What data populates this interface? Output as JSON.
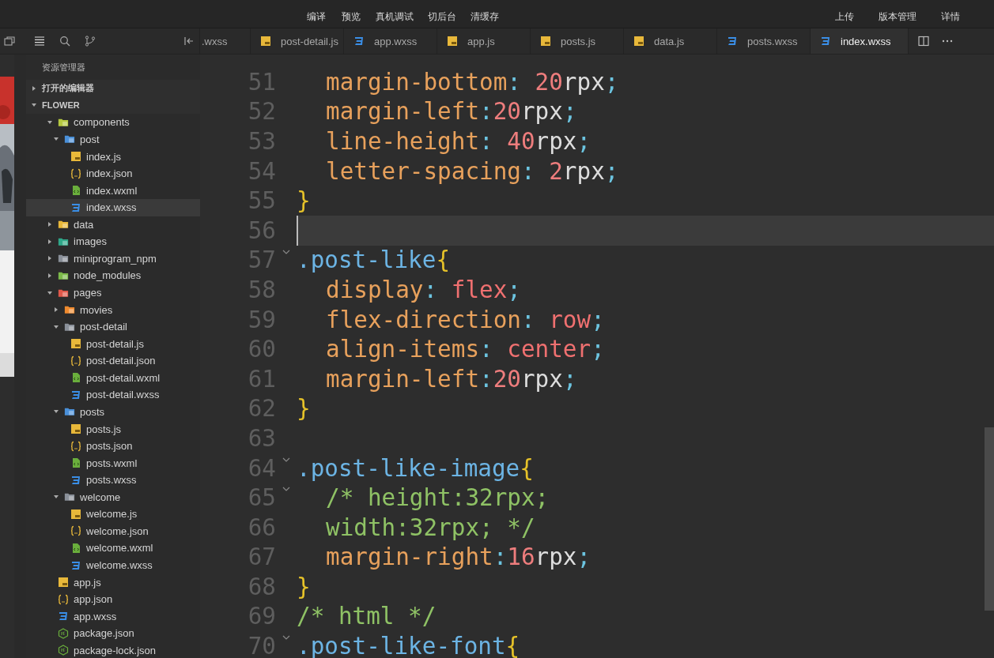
{
  "toolbar": {
    "left_buttons": [
      "编译",
      "预览",
      "真机调试",
      "切后台",
      "清缓存"
    ],
    "right_buttons": [
      "上传",
      "版本管理",
      "详情"
    ]
  },
  "sidebar": {
    "title": "资源管理器",
    "sections": [
      {
        "label": "打开的编辑器",
        "expanded": false
      },
      {
        "label": "FLOWER",
        "expanded": true,
        "children": [
          {
            "label": "components",
            "kind": "folder",
            "color": "#b5c940",
            "expanded": true,
            "selected": false,
            "children": [
              {
                "label": "post",
                "kind": "folder",
                "color": "#4a90d9",
                "expanded": true,
                "selected": false,
                "children": [
                  {
                    "label": "index.js",
                    "kind": "js",
                    "selected": false
                  },
                  {
                    "label": "index.json",
                    "kind": "json",
                    "selected": false
                  },
                  {
                    "label": "index.wxml",
                    "kind": "wxml",
                    "selected": false
                  },
                  {
                    "label": "index.wxss",
                    "kind": "wxss",
                    "selected": true
                  }
                ]
              }
            ]
          },
          {
            "label": "data",
            "kind": "folder",
            "color": "#e8b83a",
            "expanded": false,
            "selected": false
          },
          {
            "label": "images",
            "kind": "folder",
            "color": "#2fa88a",
            "expanded": false,
            "selected": false
          },
          {
            "label": "miniprogram_npm",
            "kind": "folder",
            "color": "#8a9099",
            "expanded": false,
            "selected": false
          },
          {
            "label": "node_modules",
            "kind": "folder",
            "color": "#7cba4a",
            "expanded": false,
            "selected": false
          },
          {
            "label": "pages",
            "kind": "folder",
            "color": "#e0584a",
            "expanded": true,
            "selected": false,
            "children": [
              {
                "label": "movies",
                "kind": "folder",
                "color": "#ef8a2e",
                "expanded": false,
                "selected": false
              },
              {
                "label": "post-detail",
                "kind": "folder",
                "color": "#8a9099",
                "expanded": true,
                "selected": false,
                "children": [
                  {
                    "label": "post-detail.js",
                    "kind": "js",
                    "selected": false
                  },
                  {
                    "label": "post-detail.json",
                    "kind": "json",
                    "selected": false
                  },
                  {
                    "label": "post-detail.wxml",
                    "kind": "wxml",
                    "selected": false
                  },
                  {
                    "label": "post-detail.wxss",
                    "kind": "wxss",
                    "selected": false
                  }
                ]
              },
              {
                "label": "posts",
                "kind": "folder",
                "color": "#4a90d9",
                "expanded": true,
                "selected": false,
                "children": [
                  {
                    "label": "posts.js",
                    "kind": "js",
                    "selected": false
                  },
                  {
                    "label": "posts.json",
                    "kind": "json",
                    "selected": false
                  },
                  {
                    "label": "posts.wxml",
                    "kind": "wxml",
                    "selected": false
                  },
                  {
                    "label": "posts.wxss",
                    "kind": "wxss",
                    "selected": false
                  }
                ]
              },
              {
                "label": "welcome",
                "kind": "folder",
                "color": "#8a9099",
                "expanded": true,
                "selected": false,
                "children": [
                  {
                    "label": "welcome.js",
                    "kind": "js",
                    "selected": false
                  },
                  {
                    "label": "welcome.json",
                    "kind": "json",
                    "selected": false
                  },
                  {
                    "label": "welcome.wxml",
                    "kind": "wxml",
                    "selected": false
                  },
                  {
                    "label": "welcome.wxss",
                    "kind": "wxss",
                    "selected": false
                  }
                ]
              }
            ]
          },
          {
            "label": "app.js",
            "kind": "js",
            "selected": false
          },
          {
            "label": "app.json",
            "kind": "json",
            "selected": false
          },
          {
            "label": "app.wxss",
            "kind": "wxss",
            "selected": false
          },
          {
            "label": "package.json",
            "kind": "npm",
            "selected": false
          },
          {
            "label": "package-lock.json",
            "kind": "npm",
            "selected": false
          }
        ]
      }
    ]
  },
  "tabs": [
    {
      "label": ".wxss",
      "selected": false
    },
    {
      "label": "post-detail.js",
      "kind": "js",
      "selected": false
    },
    {
      "label": "app.wxss",
      "kind": "wxss",
      "selected": false
    },
    {
      "label": "app.js",
      "kind": "js",
      "selected": false
    },
    {
      "label": "posts.js",
      "kind": "js",
      "selected": false
    },
    {
      "label": "data.js",
      "kind": "js",
      "selected": false
    },
    {
      "label": "posts.wxss",
      "kind": "wxss",
      "selected": false
    },
    {
      "label": "index.wxss",
      "kind": "wxss",
      "selected": true
    }
  ],
  "editor": {
    "lines": [
      {
        "number": "51",
        "indent": true,
        "tokens": [
          {
            "kind": "prop",
            "text": "margin-bottom"
          },
          {
            "kind": "punct",
            "text": ": "
          },
          {
            "kind": "num",
            "text": "20"
          },
          {
            "kind": "unit",
            "text": "rpx"
          },
          {
            "kind": "punct",
            "text": ";"
          }
        ]
      },
      {
        "number": "52",
        "indent": true,
        "tokens": [
          {
            "kind": "prop",
            "text": "margin-left"
          },
          {
            "kind": "punct",
            "text": ":"
          },
          {
            "kind": "num",
            "text": "20"
          },
          {
            "kind": "unit",
            "text": "rpx"
          },
          {
            "kind": "punct",
            "text": ";"
          }
        ]
      },
      {
        "number": "53",
        "indent": true,
        "tokens": [
          {
            "kind": "prop",
            "text": "line-height"
          },
          {
            "kind": "punct",
            "text": ": "
          },
          {
            "kind": "num",
            "text": "40"
          },
          {
            "kind": "unit",
            "text": "rpx"
          },
          {
            "kind": "punct",
            "text": ";"
          }
        ]
      },
      {
        "number": "54",
        "indent": true,
        "tokens": [
          {
            "kind": "prop",
            "text": "letter-spacing"
          },
          {
            "kind": "punct",
            "text": ": "
          },
          {
            "kind": "num",
            "text": "2"
          },
          {
            "kind": "unit",
            "text": "rpx"
          },
          {
            "kind": "punct",
            "text": ";"
          }
        ]
      },
      {
        "number": "55",
        "tokens": [
          {
            "kind": "brace",
            "text": "}"
          }
        ]
      },
      {
        "number": "56",
        "current": true
      },
      {
        "number": "57",
        "foldable": true,
        "tokens": [
          {
            "kind": "selector",
            "text": ".post-like"
          },
          {
            "kind": "brace",
            "text": "{"
          }
        ]
      },
      {
        "number": "58",
        "indent": true,
        "tokens": [
          {
            "kind": "prop",
            "text": "display"
          },
          {
            "kind": "punct",
            "text": ": "
          },
          {
            "kind": "value",
            "text": "flex"
          },
          {
            "kind": "punct",
            "text": ";"
          }
        ]
      },
      {
        "number": "59",
        "indent": true,
        "tokens": [
          {
            "kind": "prop",
            "text": "flex-direction"
          },
          {
            "kind": "punct",
            "text": ": "
          },
          {
            "kind": "value",
            "text": "row"
          },
          {
            "kind": "punct",
            "text": ";"
          }
        ]
      },
      {
        "number": "60",
        "indent": true,
        "tokens": [
          {
            "kind": "prop",
            "text": "align-items"
          },
          {
            "kind": "punct",
            "text": ": "
          },
          {
            "kind": "value",
            "text": "center"
          },
          {
            "kind": "punct",
            "text": ";"
          }
        ]
      },
      {
        "number": "61",
        "indent": true,
        "tokens": [
          {
            "kind": "prop",
            "text": "margin-left"
          },
          {
            "kind": "punct",
            "text": ":"
          },
          {
            "kind": "num",
            "text": "20"
          },
          {
            "kind": "unit",
            "text": "rpx"
          },
          {
            "kind": "punct",
            "text": ";"
          }
        ]
      },
      {
        "number": "62",
        "tokens": [
          {
            "kind": "brace",
            "text": "}"
          }
        ]
      },
      {
        "number": "63"
      },
      {
        "number": "64",
        "foldable": true,
        "tokens": [
          {
            "kind": "selector",
            "text": ".post-like-image"
          },
          {
            "kind": "brace",
            "text": "{"
          }
        ]
      },
      {
        "number": "65",
        "indent": true,
        "foldable": true,
        "tokens": [
          {
            "kind": "comment",
            "text": "/* height:32rpx;"
          }
        ]
      },
      {
        "number": "66",
        "indent": true,
        "tokens": [
          {
            "kind": "comment",
            "text": "width:32rpx; */"
          }
        ]
      },
      {
        "number": "67",
        "indent": true,
        "tokens": [
          {
            "kind": "prop",
            "text": "margin-right"
          },
          {
            "kind": "punct",
            "text": ":"
          },
          {
            "kind": "num",
            "text": "16"
          },
          {
            "kind": "unit",
            "text": "rpx"
          },
          {
            "kind": "punct",
            "text": ";"
          }
        ]
      },
      {
        "number": "68",
        "tokens": [
          {
            "kind": "brace",
            "text": "}"
          }
        ]
      },
      {
        "number": "69",
        "tokens": [
          {
            "kind": "comment",
            "text": "/* html */"
          }
        ]
      },
      {
        "number": "70",
        "foldable": true,
        "tokens": [
          {
            "kind": "selector",
            "text": ".post-like-font"
          },
          {
            "kind": "brace",
            "text": "{"
          }
        ]
      }
    ]
  }
}
